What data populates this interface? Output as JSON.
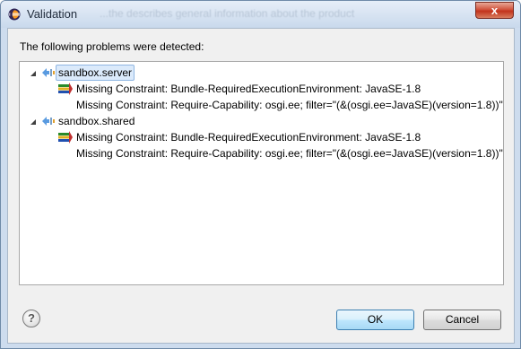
{
  "window": {
    "title": "Validation",
    "background_hint_text": "...the describes general information about the product",
    "close_label": "x"
  },
  "dialog": {
    "header": "The following problems were detected:",
    "tree": [
      {
        "label": "sandbox.server",
        "selected": true,
        "problems": [
          "Missing Constraint: Bundle-RequiredExecutionEnvironment: JavaSE-1.8",
          "Missing Constraint: Require-Capability: osgi.ee; filter=\"(&(osgi.ee=JavaSE)(version=1.8))\""
        ]
      },
      {
        "label": "sandbox.shared",
        "selected": false,
        "problems": [
          "Missing Constraint: Bundle-RequiredExecutionEnvironment: JavaSE-1.8",
          "Missing Constraint: Require-Capability: osgi.ee; filter=\"(&(osgi.ee=JavaSE)(version=1.8))\""
        ]
      }
    ],
    "help_label": "?",
    "ok_label": "OK",
    "cancel_label": "Cancel"
  },
  "colors": {
    "selection_bg": "#dbeafb",
    "selection_border": "#8fb6e2",
    "close_red": "#c2331c",
    "default_button_border": "#3c7fb1"
  },
  "icons": {
    "app": "eclipse-icon",
    "plugin": "plugin-node-icon",
    "problem": "requirement-problem-icon",
    "help": "help-icon"
  }
}
